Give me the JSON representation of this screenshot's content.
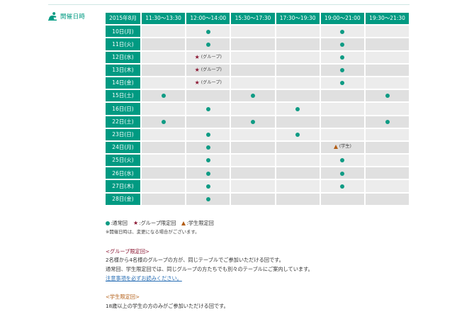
{
  "section": {
    "title": "開催日時",
    "icon": "seat-person-icon",
    "accent_color": "#009a82"
  },
  "schedule": {
    "month_header": "2015年8月",
    "time_slots": [
      "11:30〜13:30",
      "12:00〜14:00",
      "15:30〜17:30",
      "17:30〜19:30",
      "19:00〜21:00",
      "19:30〜21:30"
    ],
    "rows": [
      {
        "date": "10日(月)",
        "cells": [
          "",
          "regular",
          "",
          "",
          "regular",
          ""
        ]
      },
      {
        "date": "11日(火)",
        "cells": [
          "",
          "regular",
          "",
          "",
          "regular",
          ""
        ]
      },
      {
        "date": "12日(水)",
        "cells": [
          "",
          "group",
          "",
          "",
          "regular",
          ""
        ]
      },
      {
        "date": "13日(木)",
        "cells": [
          "",
          "group",
          "",
          "",
          "regular",
          ""
        ]
      },
      {
        "date": "14日(金)",
        "cells": [
          "",
          "group",
          "",
          "",
          "regular",
          ""
        ]
      },
      {
        "date": "15日(土)",
        "cells": [
          "regular",
          "",
          "regular",
          "",
          "",
          "regular"
        ]
      },
      {
        "date": "16日(日)",
        "cells": [
          "",
          "regular",
          "",
          "regular",
          "",
          ""
        ]
      },
      {
        "date": "22日(土)",
        "cells": [
          "regular",
          "",
          "regular",
          "",
          "",
          "regular"
        ]
      },
      {
        "date": "23日(日)",
        "cells": [
          "",
          "regular",
          "",
          "regular",
          "",
          ""
        ]
      },
      {
        "date": "24日(月)",
        "cells": [
          "",
          "regular",
          "",
          "",
          "student",
          ""
        ]
      },
      {
        "date": "25日(火)",
        "cells": [
          "",
          "regular",
          "",
          "",
          "regular",
          ""
        ]
      },
      {
        "date": "26日(水)",
        "cells": [
          "",
          "regular",
          "",
          "",
          "regular",
          ""
        ]
      },
      {
        "date": "27日(木)",
        "cells": [
          "",
          "regular",
          "",
          "",
          "regular",
          ""
        ]
      },
      {
        "date": "28日(金)",
        "cells": [
          "",
          "regular",
          "",
          "",
          "",
          ""
        ]
      }
    ],
    "mark_labels": {
      "group": "(グループ)",
      "student": "(学生)"
    }
  },
  "legend": {
    "regular": ":通常回",
    "group": ":グループ限定回",
    "student": ":学生限定回",
    "note": "※開催日時は、変更になる場合がございます。"
  },
  "group_info": {
    "heading": "<グループ限定回>",
    "line1": "2名様から4名様のグループの方が、同じテーブルでご参加いただける回です。",
    "line2": "通常回、学生限定回では、同じグループの方たちでも別々のテーブルにご案内しています。",
    "link": "注意事項を必ずお読みください。"
  },
  "student_info": {
    "heading": "<学生限定回>",
    "line1": "18歳以上の学生の方のみがご参加いただける回です。"
  },
  "colors": {
    "header_bg": "#009a82",
    "dot": "#0f9b84",
    "star": "#8a1430",
    "triangle": "#b25d14",
    "link": "#2a6fb5"
  }
}
